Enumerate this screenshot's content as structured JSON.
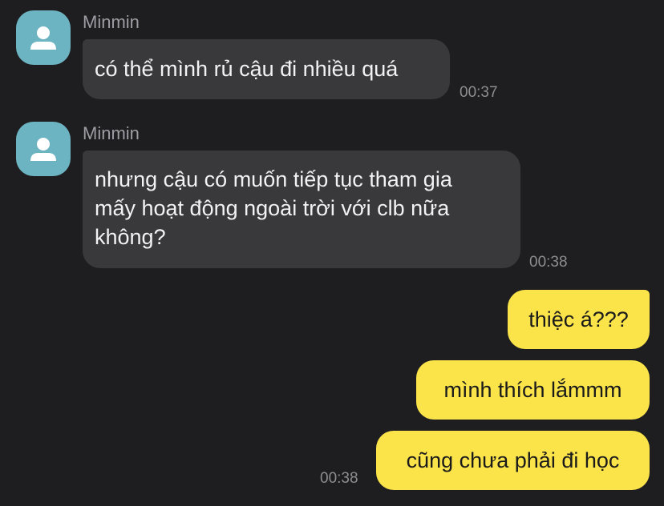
{
  "messages_in": [
    {
      "sender": "Minmin",
      "text": "có thể mình rủ cậu đi nhiều quá",
      "time": "00:37"
    },
    {
      "sender": "Minmin",
      "lines": [
        "nhưng cậu có muốn tiếp tục tham gia",
        "mấy hoạt động ngoài trời với clb nữa",
        "không?"
      ],
      "time": "00:38"
    }
  ],
  "messages_out": [
    {
      "text": "thiệc á???"
    },
    {
      "text": "mình thích lắmmm"
    },
    {
      "text": "cũng chưa phải đi học"
    }
  ],
  "out_time": "00:38",
  "colors": {
    "background": "#1e1e20",
    "incoming_bubble": "#39393c",
    "outgoing_bubble": "#fbe44a",
    "avatar": "#6db4c2"
  },
  "icons": {
    "avatar": "user-silhouette-icon"
  }
}
